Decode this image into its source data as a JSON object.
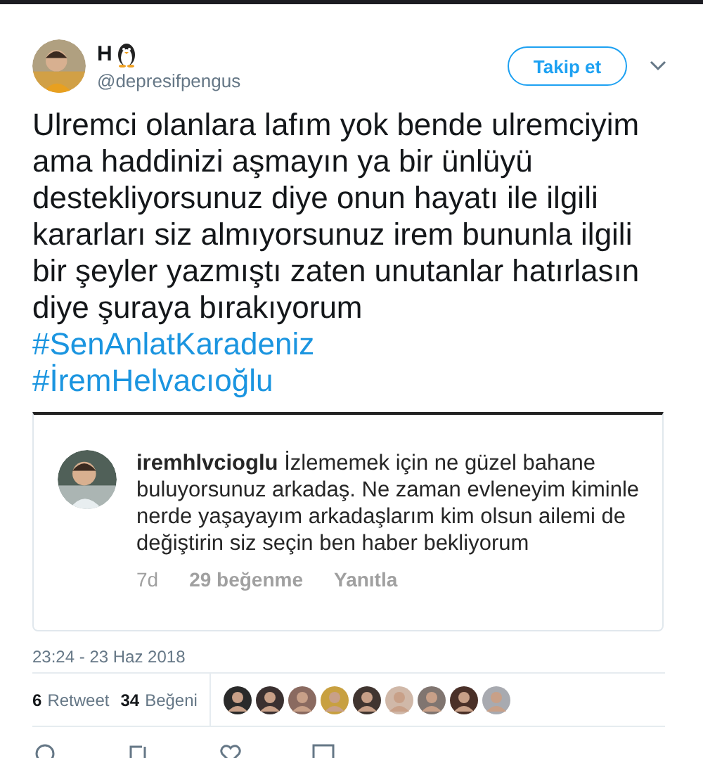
{
  "author": {
    "name": "H",
    "handle": "@depresifpengus"
  },
  "follow_button": {
    "label": "Takip et"
  },
  "tweet_text": "Ulremci olanlara lafım yok bende ulremciyim ama haddinizi aşmayın ya bir ünlüyü destekliyorsunuz diye onun hayatı ile ilgili kararları siz almıyorsunuz irem bununla ilgili bir şeyler yazmıştı zaten unutanlar hatırlasın diye şuraya bırakıyorum",
  "hashtags": [
    "#SenAnlatKaradeniz",
    "#İremHelvacıoğlu"
  ],
  "embedded_comment": {
    "username": "iremhlvcioglu",
    "text": "İzlememek için ne güzel bahane buluyorsunuz arkadaş. Ne zaman evleneyim kiminle nerde yaşayayım arkadaşlarım kim olsun ailemi de değiştirin siz seçin ben haber bekliyorum",
    "age": "7d",
    "likes": "29 beğenme",
    "reply": "Yanıtla"
  },
  "timestamp": "23:24 - 23 Haz 2018",
  "stats": [
    {
      "count": "6",
      "label": "Retweet"
    },
    {
      "count": "34",
      "label": "Beğeni"
    }
  ],
  "likers": [
    {
      "color": "#2a2a2a"
    },
    {
      "color": "#3a3030"
    },
    {
      "color": "#8a6a60"
    },
    {
      "color": "#c8a040"
    },
    {
      "color": "#403530"
    },
    {
      "color": "#d0b8a8"
    },
    {
      "color": "#807570"
    },
    {
      "color": "#4a3028"
    },
    {
      "color": "#a8aab0"
    }
  ]
}
